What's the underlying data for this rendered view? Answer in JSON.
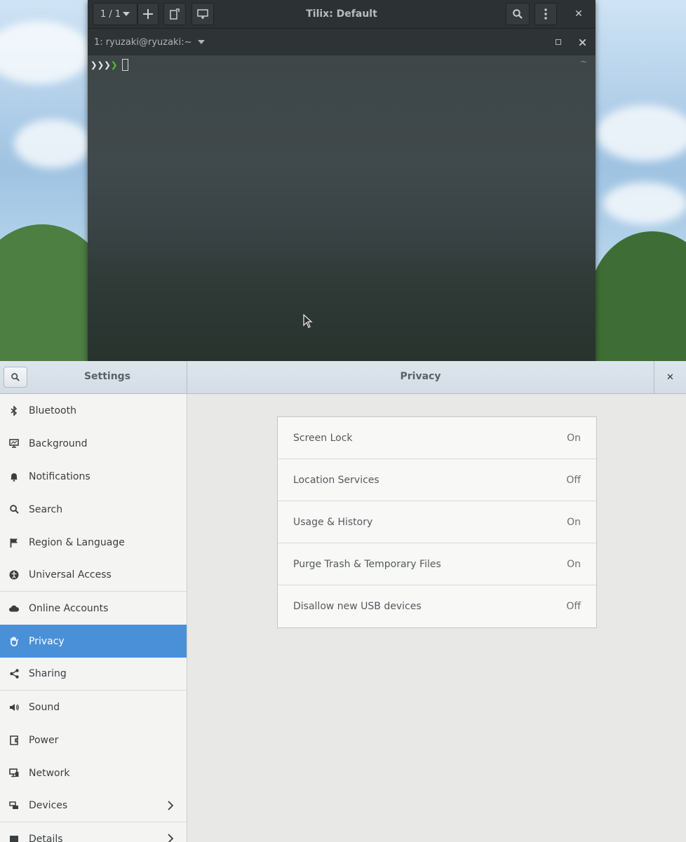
{
  "terminal": {
    "session_counter": "1 / 1",
    "title": "Tilix: Default",
    "tab_label": "1: ryuzaki@ryuzaki:~",
    "prompt_glyphs": "❯❯❯",
    "prompt_accent": "❯",
    "cwd_marker": "~",
    "close_glyph": "✕"
  },
  "settings": {
    "app_title": "Settings",
    "panel_title": "Privacy",
    "close_glyph": "✕",
    "sidebar": {
      "items": [
        {
          "label": "Bluetooth",
          "icon": "bluetooth-icon"
        },
        {
          "label": "Background",
          "icon": "background-icon"
        },
        {
          "label": "Notifications",
          "icon": "bell-icon"
        },
        {
          "label": "Search",
          "icon": "search-icon"
        },
        {
          "label": "Region & Language",
          "icon": "flag-icon"
        },
        {
          "label": "Universal Access",
          "icon": "accessibility-icon"
        },
        {
          "label": "Online Accounts",
          "icon": "cloud-icon"
        },
        {
          "label": "Privacy",
          "icon": "hand-icon"
        },
        {
          "label": "Sharing",
          "icon": "share-icon"
        },
        {
          "label": "Sound",
          "icon": "speaker-icon"
        },
        {
          "label": "Power",
          "icon": "power-icon"
        },
        {
          "label": "Network",
          "icon": "network-icon"
        },
        {
          "label": "Devices",
          "icon": "devices-icon"
        },
        {
          "label": "Details",
          "icon": "details-icon"
        }
      ]
    },
    "privacy": {
      "rows": [
        {
          "label": "Screen Lock",
          "value": "On"
        },
        {
          "label": "Location Services",
          "value": "Off"
        },
        {
          "label": "Usage & History",
          "value": "On"
        },
        {
          "label": "Purge Trash & Temporary Files",
          "value": "On"
        },
        {
          "label": "Disallow new USB devices",
          "value": "Off"
        }
      ]
    }
  },
  "colors": {
    "accent": "#4a90d9",
    "prompt_green": "#4ec32b"
  }
}
